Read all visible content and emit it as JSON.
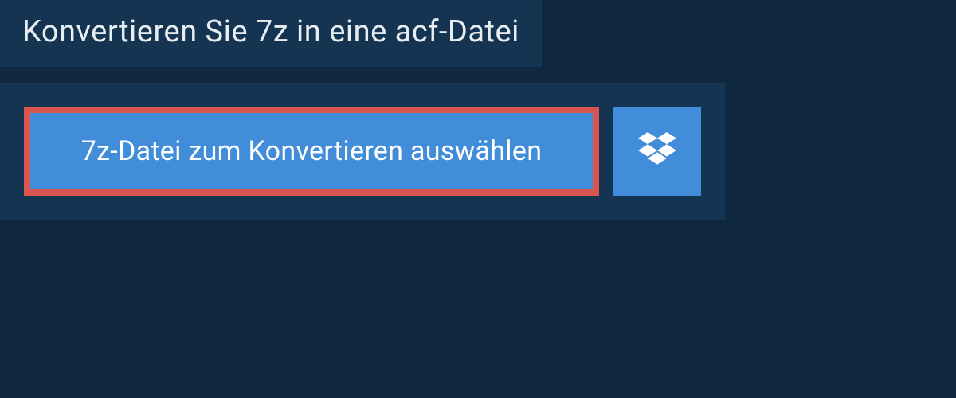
{
  "header": {
    "title": "Konvertieren Sie 7z in eine acf-Datei"
  },
  "upload": {
    "select_button_label": "7z-Datei zum Konvertieren auswählen",
    "dropbox_icon_name": "dropbox-icon"
  },
  "colors": {
    "background": "#0f2840",
    "panel": "#143452",
    "button_primary": "#418dd9",
    "highlight_border": "#d9554f",
    "text_light": "#e8edf2"
  }
}
